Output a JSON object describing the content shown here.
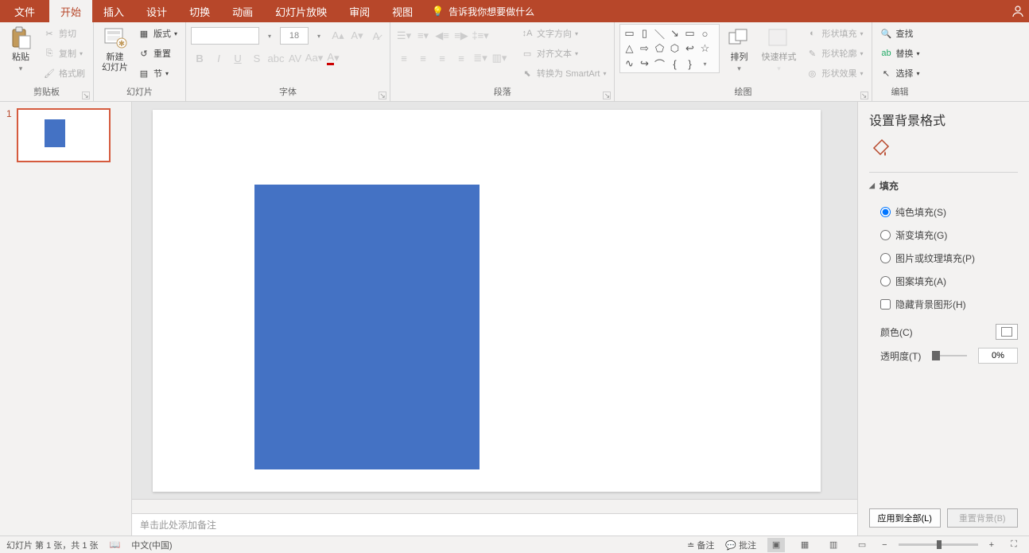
{
  "tabs": {
    "file": "文件",
    "home": "开始",
    "insert": "插入",
    "design": "设计",
    "transition": "切换",
    "animation": "动画",
    "slideshow": "幻灯片放映",
    "review": "审阅",
    "view": "视图"
  },
  "search_hint": "告诉我你想要做什么",
  "ribbon": {
    "clipboard": {
      "label": "剪贴板",
      "paste": "粘贴",
      "cut": "剪切",
      "copy": "复制",
      "format_painter": "格式刷"
    },
    "slides": {
      "label": "幻灯片",
      "new_slide": "新建\n幻灯片",
      "layout": "版式",
      "reset": "重置",
      "section": "节"
    },
    "font": {
      "label": "字体",
      "size": "18"
    },
    "paragraph": {
      "label": "段落",
      "text_direction": "文字方向",
      "align_text": "对齐文本",
      "convert_smartart": "转换为 SmartArt"
    },
    "drawing": {
      "label": "绘图",
      "arrange": "排列",
      "quick_styles": "快速样式",
      "shape_fill": "形状填充",
      "shape_outline": "形状轮廓",
      "shape_effects": "形状效果"
    },
    "editing": {
      "label": "编辑",
      "find": "查找",
      "replace": "替换",
      "select": "选择"
    }
  },
  "thumb": {
    "num": "1"
  },
  "notes_placeholder": "单击此处添加备注",
  "panel": {
    "title": "设置背景格式",
    "section_fill": "填充",
    "solid_fill": "纯色填充(S)",
    "gradient_fill": "渐变填充(G)",
    "picture_fill": "图片或纹理填充(P)",
    "pattern_fill": "图案填充(A)",
    "hide_bg": "隐藏背景图形(H)",
    "color": "颜色(C)",
    "transparency": "透明度(T)",
    "transparency_value": "0%",
    "apply_all": "应用到全部(L)",
    "reset_bg": "重置背景(B)"
  },
  "status": {
    "slide_info": "幻灯片 第 1 张，共 1 张",
    "language": "中文(中国)",
    "notes": "备注",
    "comments": "批注"
  }
}
